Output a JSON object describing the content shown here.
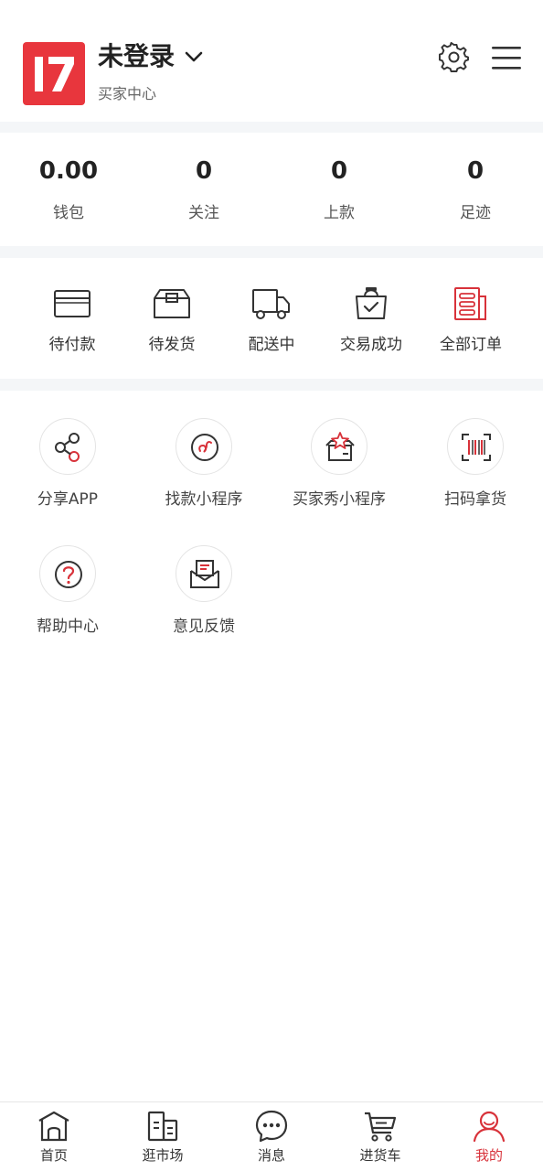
{
  "header": {
    "logo_text": "17",
    "title": "未登录",
    "subtitle": "买家中心",
    "settings_icon": "gear-icon",
    "menu_icon": "hamburger-menu-icon"
  },
  "stats": [
    {
      "value": "0.00",
      "label": "钱包"
    },
    {
      "value": "0",
      "label": "关注"
    },
    {
      "value": "0",
      "label": "上款"
    },
    {
      "value": "0",
      "label": "足迹"
    }
  ],
  "orders": [
    {
      "label": "待付款",
      "icon": "card-icon"
    },
    {
      "label": "待发货",
      "icon": "box-icon"
    },
    {
      "label": "配送中",
      "icon": "truck-icon"
    },
    {
      "label": "交易成功",
      "icon": "bag-check-icon"
    },
    {
      "label": "全部订单",
      "icon": "order-list-icon"
    }
  ],
  "tools": [
    {
      "label": "分享APP",
      "icon": "share-icon"
    },
    {
      "label": "找款小程序",
      "icon": "mini-program-icon"
    },
    {
      "label": "买家秀小程序",
      "icon": "star-box-icon"
    },
    {
      "label": "扫码拿货",
      "icon": "barcode-scan-icon"
    },
    {
      "label": "帮助中心",
      "icon": "help-icon"
    },
    {
      "label": "意见反馈",
      "icon": "feedback-mail-icon"
    }
  ],
  "tabbar": [
    {
      "label": "首页",
      "icon": "home-icon",
      "active": false
    },
    {
      "label": "逛市场",
      "icon": "market-icon",
      "active": false
    },
    {
      "label": "消息",
      "icon": "message-icon",
      "active": false
    },
    {
      "label": "进货车",
      "icon": "cart-icon",
      "active": false
    },
    {
      "label": "我的",
      "icon": "profile-icon",
      "active": true
    }
  ],
  "colors": {
    "accent": "#d8323a",
    "logo_bg": "#e8363d",
    "divider": "#f4f6f8"
  }
}
